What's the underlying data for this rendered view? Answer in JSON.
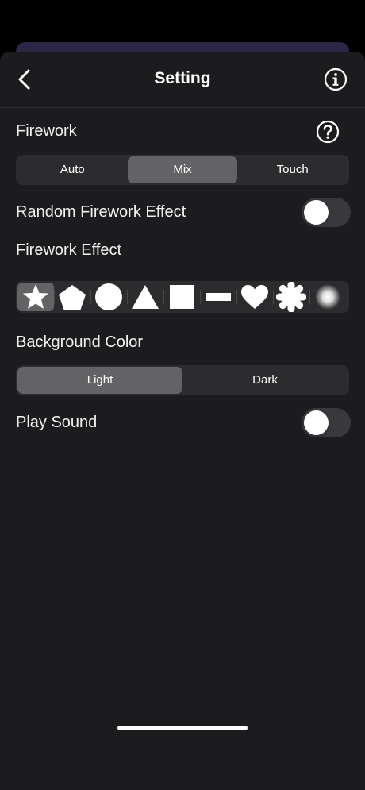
{
  "nav": {
    "title": "Setting",
    "back_icon": "chevron-left-icon",
    "info_icon": "info-circle-icon"
  },
  "firework": {
    "label": "Firework",
    "help_icon": "question-circle-icon",
    "modes": [
      "Auto",
      "Mix",
      "Touch"
    ],
    "selected_mode": "Mix"
  },
  "random_effect": {
    "label": "Random Firework Effect",
    "enabled": false
  },
  "effect": {
    "label": "Firework Effect",
    "shapes": [
      "star",
      "pentagon",
      "circle",
      "triangle",
      "square",
      "bar",
      "heart",
      "asterisk",
      "glow"
    ],
    "selected": "star"
  },
  "background": {
    "label": "Background Color",
    "options": [
      "Light",
      "Dark"
    ],
    "selected": "Light"
  },
  "sound": {
    "label": "Play Sound",
    "enabled": false
  },
  "colors": {
    "sheet": "#1c1c1e",
    "control": "#2c2c2e",
    "selected": "#636366",
    "accent_card": "#2c2747"
  }
}
